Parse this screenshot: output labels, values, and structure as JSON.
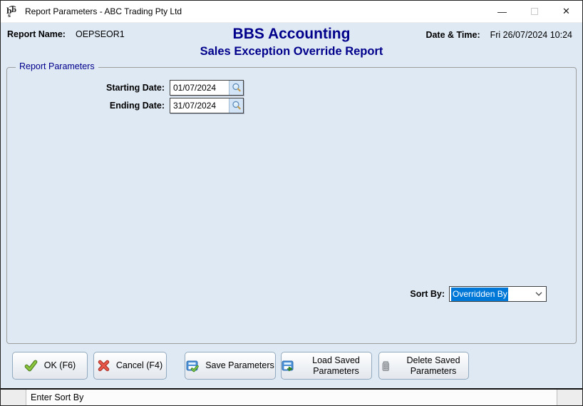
{
  "window": {
    "title": "Report Parameters - ABC Trading Pty Ltd",
    "minimize_glyph": "—",
    "close_glyph": "✕"
  },
  "header": {
    "report_name_label": "Report Name:",
    "report_name_value": "OEPSEOR1",
    "app_title": "BBS Accounting",
    "report_title": "Sales Exception Override Report",
    "datetime_label": "Date & Time:",
    "datetime_value": "Fri 26/07/2024 10:24"
  },
  "parameters": {
    "group_label": "Report Parameters",
    "starting_date": {
      "label": "Starting Date:",
      "value": "01/07/2024"
    },
    "ending_date": {
      "label": "Ending Date:",
      "value": "31/07/2024"
    },
    "sort_by": {
      "label": "Sort By:",
      "value": "Overridden By"
    }
  },
  "buttons": {
    "ok": "OK (F6)",
    "cancel": "Cancel (F4)",
    "save": "Save Parameters",
    "load": "Load Saved Parameters",
    "delete": "Delete Saved Parameters"
  },
  "status_bar": {
    "message": "Enter Sort By"
  },
  "icons": {
    "app": "bbs-logo",
    "lookup": "magnifier",
    "ok": "green-check",
    "cancel": "red-cross",
    "save": "disk-with-check",
    "load": "disk-with-arrow",
    "delete": "gray-bin",
    "combobox": "chevron-down"
  },
  "colors": {
    "navy_title": "#00008B",
    "selection_blue": "#0078d7",
    "panel_bg": "#dfe9f4",
    "ok_green": "#6aaa2f",
    "cancel_red": "#d23c3c"
  }
}
